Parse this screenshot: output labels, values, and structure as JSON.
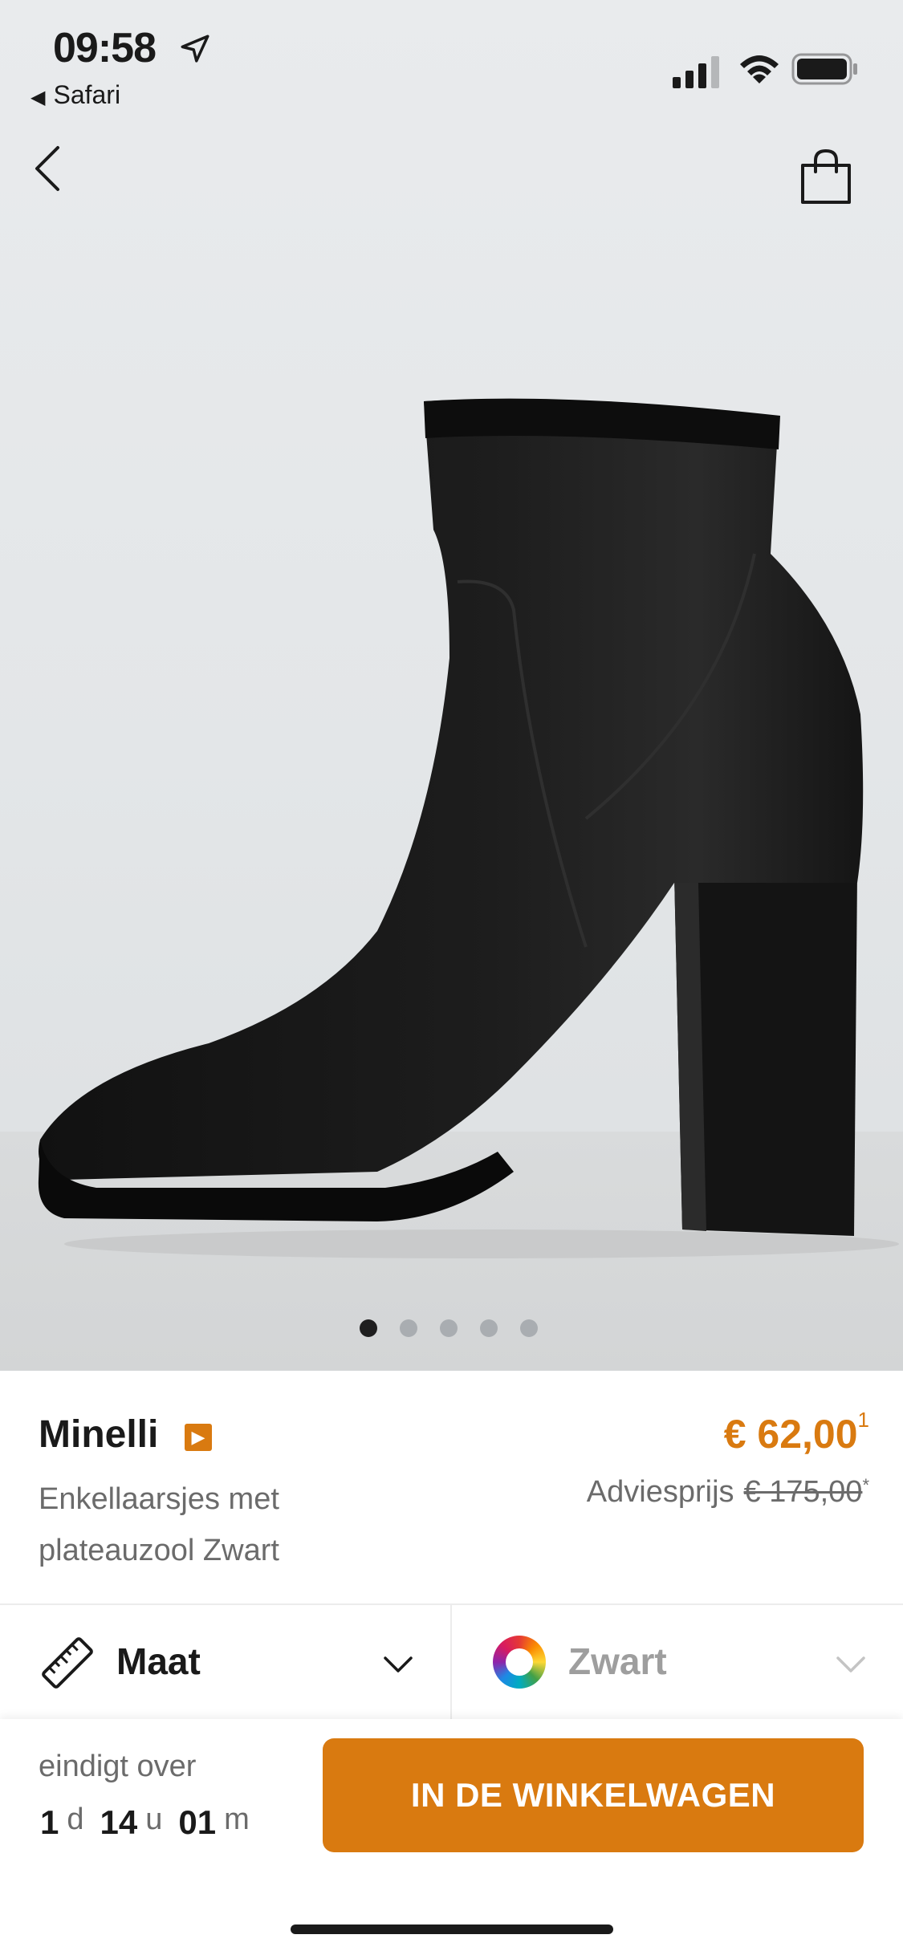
{
  "status_bar": {
    "time": "09:58",
    "back_app": "Safari"
  },
  "gallery": {
    "image_count": 5,
    "active_index": 0
  },
  "product": {
    "brand": "Minelli",
    "brand_badge_icon": "chevron-right-badge-icon",
    "name": "Enkellaarsjes met plateauzool Zwart",
    "price": "€ 62,00",
    "price_footnote": "1",
    "advies_label": "Adviesprijs",
    "advies_price": "€ 175,00",
    "advies_footnote": "*"
  },
  "selectors": {
    "size_label": "Maat",
    "color_label": "Zwart"
  },
  "footer": {
    "ends_label": "eindigt over",
    "days": "1",
    "days_unit": "d",
    "hours": "14",
    "hours_unit": "u",
    "minutes": "01",
    "minutes_unit": "m",
    "cart_button": "IN DE WINKELWAGEN"
  },
  "colors": {
    "accent": "#d97a10",
    "text": "#1a1a1a",
    "muted": "#6b6b6b"
  }
}
